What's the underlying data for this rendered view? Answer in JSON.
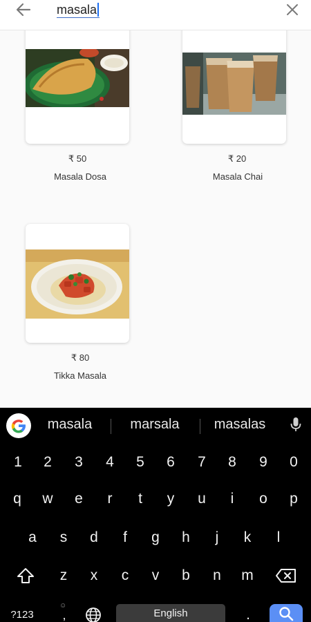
{
  "search": {
    "query": "masala",
    "back_icon": "arrow-left-icon",
    "clear_icon": "close-icon"
  },
  "results": [
    {
      "price": "₹ 50",
      "name": "Masala Dosa",
      "image": "masala-dosa-photo"
    },
    {
      "price": "₹ 20",
      "name": "Masala Chai",
      "image": "masala-chai-photo"
    },
    {
      "price": "₹ 80",
      "name": "Tikka Masala",
      "image": "tikka-masala-photo"
    }
  ],
  "keyboard": {
    "suggestions": [
      "masala",
      "marsala",
      "masalas"
    ],
    "number_row": [
      "1",
      "2",
      "3",
      "4",
      "5",
      "6",
      "7",
      "8",
      "9",
      "0"
    ],
    "row_qwerty": [
      "q",
      "w",
      "e",
      "r",
      "t",
      "y",
      "u",
      "i",
      "o",
      "p"
    ],
    "row_asdf": [
      "a",
      "s",
      "d",
      "f",
      "g",
      "h",
      "j",
      "k",
      "l"
    ],
    "row_zxcv": [
      "z",
      "x",
      "c",
      "v",
      "b",
      "n",
      "m"
    ],
    "symbols_key": "?123",
    "comma_key": ",",
    "period_key": ".",
    "space_label": "English",
    "colors": {
      "background": "#000000",
      "space": "#3b3b3b",
      "action": "#5b8ff5"
    }
  }
}
